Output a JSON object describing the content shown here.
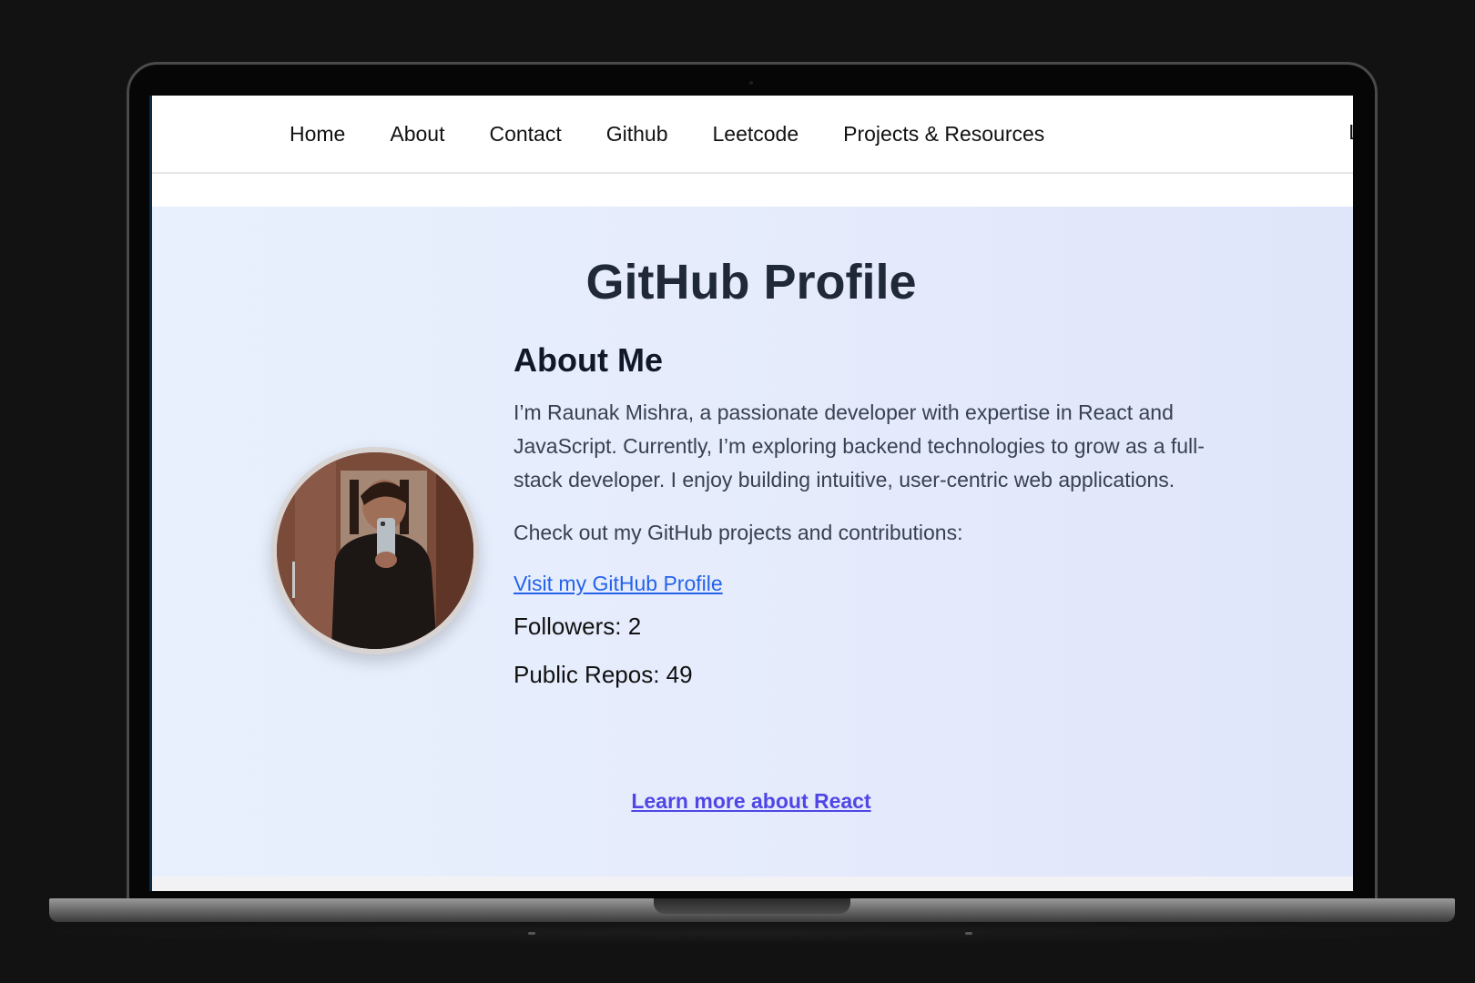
{
  "nav": {
    "items": [
      "Home",
      "About",
      "Contact",
      "Github",
      "Leetcode",
      "Projects & Resources"
    ],
    "cutoff_label": "L"
  },
  "page": {
    "title": "GitHub Profile"
  },
  "about": {
    "heading": "About Me",
    "bio": "I’m Raunak Mishra, a passionate developer with expertise in React and JavaScript. Currently, I’m exploring backend technologies to grow as a full-stack developer. I enjoy building intuitive, user-centric web applications.",
    "check_text": "Check out my GitHub projects and contributions:",
    "profile_link": "Visit my GitHub Profile",
    "followers": "Followers: 2",
    "public_repos": "Public Repos: 49"
  },
  "footer_link": "Learn more about React",
  "colors": {
    "link": "#2563eb",
    "accent": "#4f46e5",
    "title": "#1f2937"
  }
}
